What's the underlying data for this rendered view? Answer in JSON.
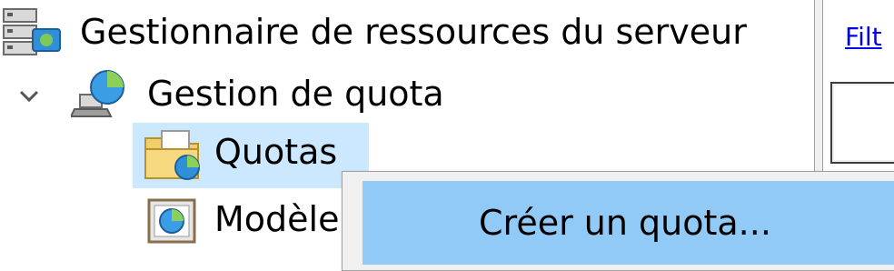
{
  "tree": {
    "root": {
      "label": "Gestionnaire de ressources du serveur",
      "icon": "server-manager-icon"
    },
    "quota_management": {
      "label": "Gestion de quota",
      "icon": "quota-management-icon",
      "expander": "chevron-down-icon"
    },
    "quotas": {
      "label": "Quotas",
      "icon": "quota-folder-icon"
    },
    "templates": {
      "label": "Modèle",
      "icon": "quota-template-icon"
    }
  },
  "right_pane": {
    "filter_link": "Filt"
  },
  "context_menu": {
    "items": [
      {
        "label": "Créer un quota..."
      }
    ]
  },
  "colors": {
    "selection": "#cce8ff",
    "menu_highlight": "#91c9f7",
    "link": "#0000ee"
  }
}
